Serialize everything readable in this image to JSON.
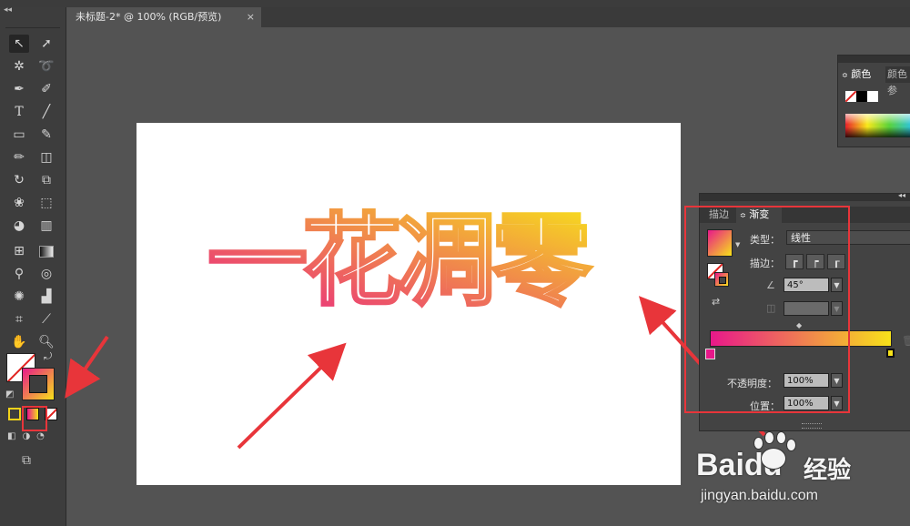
{
  "window": {
    "doc_tab_title": "未标题-2* @ 100% (RGB/预览)",
    "close_glyph": "×",
    "collapse_glyph": "◂◂"
  },
  "artboard": {
    "text": "一花凋零",
    "gradient": {
      "start": "#e8188a",
      "end": "#f7e21a"
    }
  },
  "toolbar": {
    "tools": [
      "selection-tool",
      "direct-selection-tool",
      "magic-wand-tool",
      "lasso-tool",
      "pen-tool",
      "curvature-tool",
      "type-tool",
      "line-tool",
      "rectangle-tool",
      "paintbrush-tool",
      "pencil-tool",
      "eraser-tool",
      "rotate-tool",
      "scale-tool",
      "warp-tool",
      "free-transform-tool",
      "shape-builder-tool",
      "perspective-grid-tool",
      "mesh-tool",
      "gradient-tool",
      "eyedropper-tool",
      "blend-tool",
      "symbol-sprayer-tool",
      "column-graph-tool",
      "artboard-tool",
      "slice-tool",
      "hand-tool",
      "zoom-tool"
    ]
  },
  "color_panel": {
    "tab_active": "颜色",
    "tab_other": "颜色参"
  },
  "gradient_panel": {
    "tab_stroke": "描边",
    "tab_gradient": "渐变",
    "type_label": "类型：",
    "type_value": "线性",
    "stroke_label": "描边：",
    "angle_value": "45°",
    "opacity_label": "不透明度：",
    "opacity_value": "100%",
    "position_label": "位置：",
    "position_value": "100%"
  },
  "watermark": {
    "brand": "Baidu",
    "brand_cn": "经验",
    "url": "jingyan.baidu.com"
  },
  "colors": {
    "highlight": "#e8353a",
    "gradient_start": "#e8188a",
    "gradient_end": "#f7e21a"
  }
}
